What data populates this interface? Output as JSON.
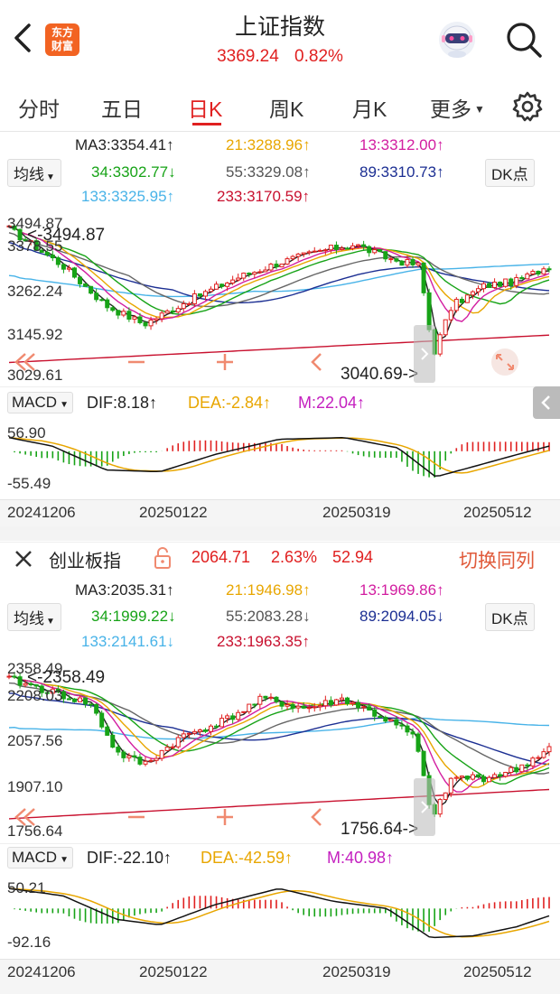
{
  "header": {
    "title": "上证指数",
    "price": "3369.24",
    "change_pct": "0.82%",
    "logo_text": "东方财富"
  },
  "tabs": [
    {
      "label": "分时",
      "active": false
    },
    {
      "label": "五日",
      "active": false
    },
    {
      "label": "日K",
      "active": true
    },
    {
      "label": "周K",
      "active": false
    },
    {
      "label": "月K",
      "active": false
    },
    {
      "label": "更多",
      "active": false
    }
  ],
  "chart1": {
    "ma_selector": "均线",
    "dk_button": "DK点",
    "ma": {
      "ma3": "MA3:3354.41↑",
      "ma21": "21:3288.96↑",
      "ma13": "13:3312.00↑",
      "ma34": "34:3302.77↓",
      "ma55": "55:3329.08↑",
      "ma89": "89:3310.73↑",
      "ma133": "133:3325.95↑",
      "ma233": "233:3170.59↑"
    },
    "price_axis": [
      "3494.87",
      "3378.55",
      "3262.24",
      "3145.92",
      "3029.61"
    ],
    "high_label": "3494.87",
    "low_label": "3040.69->",
    "macd_label": "MACD",
    "dif": "DIF:8.18↑",
    "dea": "DEA:-2.84↑",
    "m": "M:22.04↑",
    "macd_axis": [
      "56.90",
      "-55.49"
    ],
    "dates": [
      "20241206",
      "20250122",
      "20250319",
      "20250512"
    ]
  },
  "chart2": {
    "name": "创业板指",
    "price": "2064.71",
    "change_pct": "2.63%",
    "change": "52.94",
    "switch_label": "切换同列",
    "ma_selector": "均线",
    "dk_button": "DK点",
    "ma": {
      "ma3": "MA3:2035.31↑",
      "ma21": "21:1946.98↑",
      "ma13": "13:1969.86↑",
      "ma34": "34:1999.22↓",
      "ma55": "55:2083.28↓",
      "ma89": "89:2094.05↓",
      "ma133": "133:2141.61↓",
      "ma233": "233:1963.35↑"
    },
    "price_axis": [
      "2358.49",
      "2208.03",
      "2057.56",
      "1907.10",
      "1756.64"
    ],
    "high_label": "2358.49",
    "low_label": "1756.64->",
    "macd_label": "MACD",
    "dif": "DIF:-22.10↑",
    "dea": "DEA:-42.59↑",
    "m": "M:40.98↑",
    "macd_axis": [
      "50.21",
      "-92.16"
    ],
    "dates": [
      "20241206",
      "20250122",
      "20250319",
      "20250512"
    ]
  },
  "colors": {
    "up": "#e02020",
    "down": "#17a317",
    "ma3": "#222222",
    "ma13": "#d21da0",
    "ma21": "#e8a600",
    "ma34": "#17a317",
    "ma55": "#666666",
    "ma89": "#1c2f93",
    "ma133": "#48b3e8",
    "ma233": "#c8102e"
  },
  "icons": {
    "back": "chevron-left-icon",
    "search": "search-icon",
    "settings": "gear-icon",
    "close": "close-icon",
    "lock": "lock-icon",
    "assistant": "robot-avatar-icon"
  }
}
